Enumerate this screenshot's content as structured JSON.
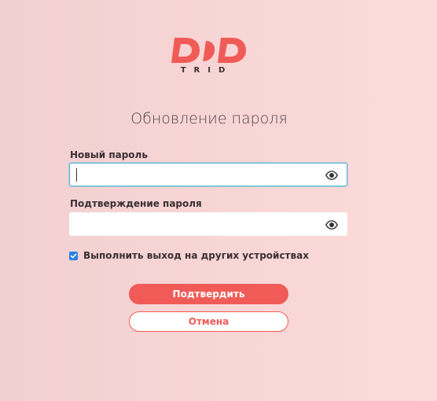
{
  "brand": {
    "logo_subtitle": "TRID",
    "accent_color": "#f05b58"
  },
  "page": {
    "title": "Обновление пароля"
  },
  "form": {
    "new_password": {
      "label": "Новый пароль",
      "value": "",
      "placeholder": "",
      "focused": true,
      "toggle_icon": "eye-icon"
    },
    "confirm_password": {
      "label": "Подтверждение пароля",
      "value": "",
      "placeholder": "",
      "toggle_icon": "eye-icon"
    },
    "logout_other_devices": {
      "label": "Выполнить выход на других устройствах",
      "checked": true
    },
    "submit_label": "Подтвердить",
    "cancel_label": "Отмена"
  }
}
